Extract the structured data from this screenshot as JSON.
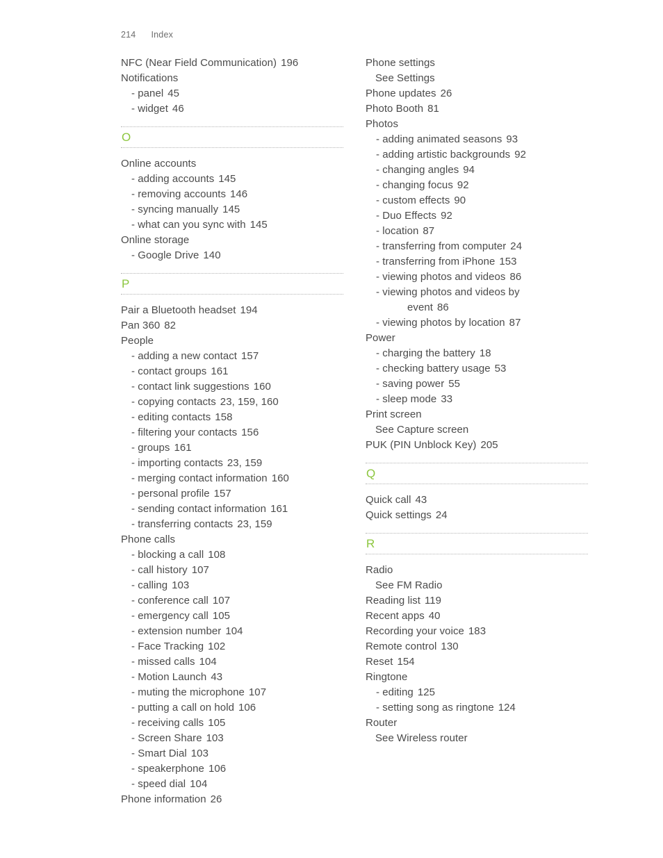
{
  "header": {
    "folio": "214",
    "title": "Index"
  },
  "colors": {
    "section_letter": "#8cc63e",
    "body_text": "#4b4b4b",
    "header_text": "#6e6e6e",
    "rule": "#b4b4b4"
  },
  "columns": [
    {
      "name": "left-column",
      "blocks": [
        {
          "type": "entries",
          "entries": [
            {
              "level": 0,
              "text": "NFC (Near Field Communication)",
              "page": "196"
            },
            {
              "level": 0,
              "text": "Notifications",
              "page": ""
            },
            {
              "level": 1,
              "text": "- panel",
              "page": "45"
            },
            {
              "level": 1,
              "text": "- widget",
              "page": "46"
            }
          ]
        },
        {
          "type": "section",
          "letter": "O"
        },
        {
          "type": "entries",
          "entries": [
            {
              "level": 0,
              "text": "Online accounts",
              "page": ""
            },
            {
              "level": 1,
              "text": "- adding accounts",
              "page": "145"
            },
            {
              "level": 1,
              "text": "- removing accounts",
              "page": "146"
            },
            {
              "level": 1,
              "text": "- syncing manually",
              "page": "145"
            },
            {
              "level": 1,
              "text": "- what can you sync with",
              "page": "145"
            },
            {
              "level": 0,
              "text": "Online storage",
              "page": ""
            },
            {
              "level": 1,
              "text": "- Google Drive",
              "page": "140"
            }
          ]
        },
        {
          "type": "section",
          "letter": "P"
        },
        {
          "type": "entries",
          "entries": [
            {
              "level": 0,
              "text": "Pair a Bluetooth headset",
              "page": "194"
            },
            {
              "level": 0,
              "text": "Pan 360",
              "page": "82"
            },
            {
              "level": 0,
              "text": "People",
              "page": ""
            },
            {
              "level": 1,
              "text": "- adding a new contact",
              "page": "157"
            },
            {
              "level": 1,
              "text": "- contact groups",
              "page": "161"
            },
            {
              "level": 1,
              "text": "- contact link suggestions",
              "page": "160"
            },
            {
              "level": 1,
              "text": "- copying contacts",
              "page": "23, 159, 160"
            },
            {
              "level": 1,
              "text": "- editing contacts",
              "page": "158"
            },
            {
              "level": 1,
              "text": "- filtering your contacts",
              "page": "156"
            },
            {
              "level": 1,
              "text": "- groups",
              "page": "161"
            },
            {
              "level": 1,
              "text": "- importing contacts",
              "page": "23, 159"
            },
            {
              "level": 1,
              "text": "- merging contact information",
              "page": "160"
            },
            {
              "level": 1,
              "text": "- personal profile",
              "page": "157"
            },
            {
              "level": 1,
              "text": "- sending contact information",
              "page": "161"
            },
            {
              "level": 1,
              "text": "- transferring contacts",
              "page": "23, 159"
            },
            {
              "level": 0,
              "text": "Phone calls",
              "page": ""
            },
            {
              "level": 1,
              "text": "- blocking a call",
              "page": "108"
            },
            {
              "level": 1,
              "text": "- call history",
              "page": "107"
            },
            {
              "level": 1,
              "text": "- calling",
              "page": "103"
            },
            {
              "level": 1,
              "text": "- conference call",
              "page": "107"
            },
            {
              "level": 1,
              "text": "- emergency call",
              "page": "105"
            },
            {
              "level": 1,
              "text": "- extension number",
              "page": "104"
            },
            {
              "level": 1,
              "text": "- Face Tracking",
              "page": "102"
            },
            {
              "level": 1,
              "text": "- missed calls",
              "page": "104"
            },
            {
              "level": 1,
              "text": "- Motion Launch",
              "page": "43"
            },
            {
              "level": 1,
              "text": "- muting the microphone",
              "page": "107"
            },
            {
              "level": 1,
              "text": "- putting a call on hold",
              "page": "106"
            },
            {
              "level": 1,
              "text": "- receiving calls",
              "page": "105"
            },
            {
              "level": 1,
              "text": "- Screen Share",
              "page": "103"
            },
            {
              "level": 1,
              "text": "- Smart Dial",
              "page": "103"
            },
            {
              "level": 1,
              "text": "- speakerphone",
              "page": "106"
            },
            {
              "level": 1,
              "text": "- speed dial",
              "page": "104"
            },
            {
              "level": 0,
              "text": "Phone information",
              "page": "26"
            }
          ]
        }
      ]
    },
    {
      "name": "right-column",
      "blocks": [
        {
          "type": "entries",
          "entries": [
            {
              "level": 0,
              "text": "Phone settings",
              "page": ""
            },
            {
              "level": 2,
              "text": "See Settings",
              "page": ""
            },
            {
              "level": 0,
              "text": "Phone updates",
              "page": "26"
            },
            {
              "level": 0,
              "text": "Photo Booth",
              "page": "81"
            },
            {
              "level": 0,
              "text": "Photos",
              "page": ""
            },
            {
              "level": 1,
              "text": "- adding animated seasons",
              "page": "93"
            },
            {
              "level": 1,
              "text": "- adding artistic backgrounds",
              "page": "92"
            },
            {
              "level": 1,
              "text": "- changing angles",
              "page": "94"
            },
            {
              "level": 1,
              "text": "- changing focus",
              "page": "92"
            },
            {
              "level": 1,
              "text": "- custom effects",
              "page": "90"
            },
            {
              "level": 1,
              "text": "- Duo Effects",
              "page": "92"
            },
            {
              "level": 1,
              "text": "- location",
              "page": "87"
            },
            {
              "level": 1,
              "text": "- transferring from computer",
              "page": "24"
            },
            {
              "level": 1,
              "text": "- transferring from iPhone",
              "page": "153"
            },
            {
              "level": 1,
              "text": "- viewing photos and videos",
              "page": "86"
            },
            {
              "level": 1,
              "text": "- viewing photos and videos by",
              "page": ""
            },
            {
              "level": 3,
              "text": "event",
              "page": "86"
            },
            {
              "level": 1,
              "text": "- viewing photos by location",
              "page": "87"
            },
            {
              "level": 0,
              "text": "Power",
              "page": ""
            },
            {
              "level": 1,
              "text": "- charging the battery",
              "page": "18"
            },
            {
              "level": 1,
              "text": "- checking battery usage",
              "page": "53"
            },
            {
              "level": 1,
              "text": "- saving power",
              "page": "55"
            },
            {
              "level": 1,
              "text": "- sleep mode",
              "page": "33"
            },
            {
              "level": 0,
              "text": "Print screen",
              "page": ""
            },
            {
              "level": 2,
              "text": "See Capture screen",
              "page": ""
            },
            {
              "level": 0,
              "text": "PUK (PIN Unblock Key)",
              "page": "205"
            }
          ]
        },
        {
          "type": "section",
          "letter": "Q"
        },
        {
          "type": "entries",
          "entries": [
            {
              "level": 0,
              "text": "Quick call",
              "page": "43"
            },
            {
              "level": 0,
              "text": "Quick settings",
              "page": "24"
            }
          ]
        },
        {
          "type": "section",
          "letter": "R"
        },
        {
          "type": "entries",
          "entries": [
            {
              "level": 0,
              "text": "Radio",
              "page": ""
            },
            {
              "level": 2,
              "text": "See FM Radio",
              "page": ""
            },
            {
              "level": 0,
              "text": "Reading list",
              "page": "119"
            },
            {
              "level": 0,
              "text": "Recent apps",
              "page": "40"
            },
            {
              "level": 0,
              "text": "Recording your voice",
              "page": "183"
            },
            {
              "level": 0,
              "text": "Remote control",
              "page": "130"
            },
            {
              "level": 0,
              "text": "Reset",
              "page": "154"
            },
            {
              "level": 0,
              "text": "Ringtone",
              "page": ""
            },
            {
              "level": 1,
              "text": "- editing",
              "page": "125"
            },
            {
              "level": 1,
              "text": "- setting song as ringtone",
              "page": "124"
            },
            {
              "level": 0,
              "text": "Router",
              "page": ""
            },
            {
              "level": 2,
              "text": "See Wireless router",
              "page": ""
            }
          ]
        }
      ]
    }
  ]
}
